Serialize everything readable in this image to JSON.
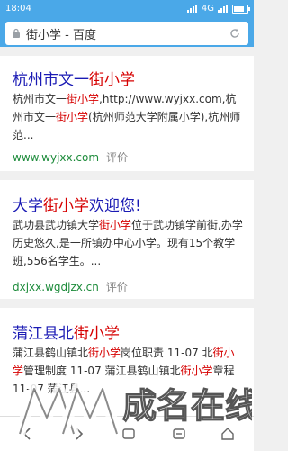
{
  "status": {
    "time": "18:04",
    "network": "4G"
  },
  "search": {
    "query": "街小学 - 百度"
  },
  "results": [
    {
      "title_parts": [
        "杭州市文一",
        "街小学",
        ""
      ],
      "snippet_parts": [
        "杭州市文一",
        "街小学",
        ",http://www.wyjxx.com,杭州市文一",
        "街小学",
        "(杭州师范大学附属小学),杭州师范..."
      ],
      "url": "www.wyjxx.com",
      "eval": "评价"
    },
    {
      "title_parts": [
        "大学",
        "街小学",
        "欢迎您!"
      ],
      "snippet_parts": [
        "武功县武功镇大学",
        "街小学",
        "位于武功镇学前街,办学历史悠久,是一所镇办中心小学。现有15个教学班,556名学生。..."
      ],
      "url": "dxjxx.wgdjzx.cn",
      "eval": "评价"
    },
    {
      "title_parts": [
        "蒲江县北",
        "街小学",
        ""
      ],
      "snippet_parts": [
        "蒲江县鹤山镇北",
        "街小学",
        "岗位职责 11-07 北",
        "街小学",
        "管理制度 11-07 蒲江县鹤山镇北",
        "街小学",
        "章程 11-07 蒲江县..."
      ],
      "url": "",
      "eval": ""
    }
  ],
  "watermark": {
    "text": "成名在线"
  }
}
